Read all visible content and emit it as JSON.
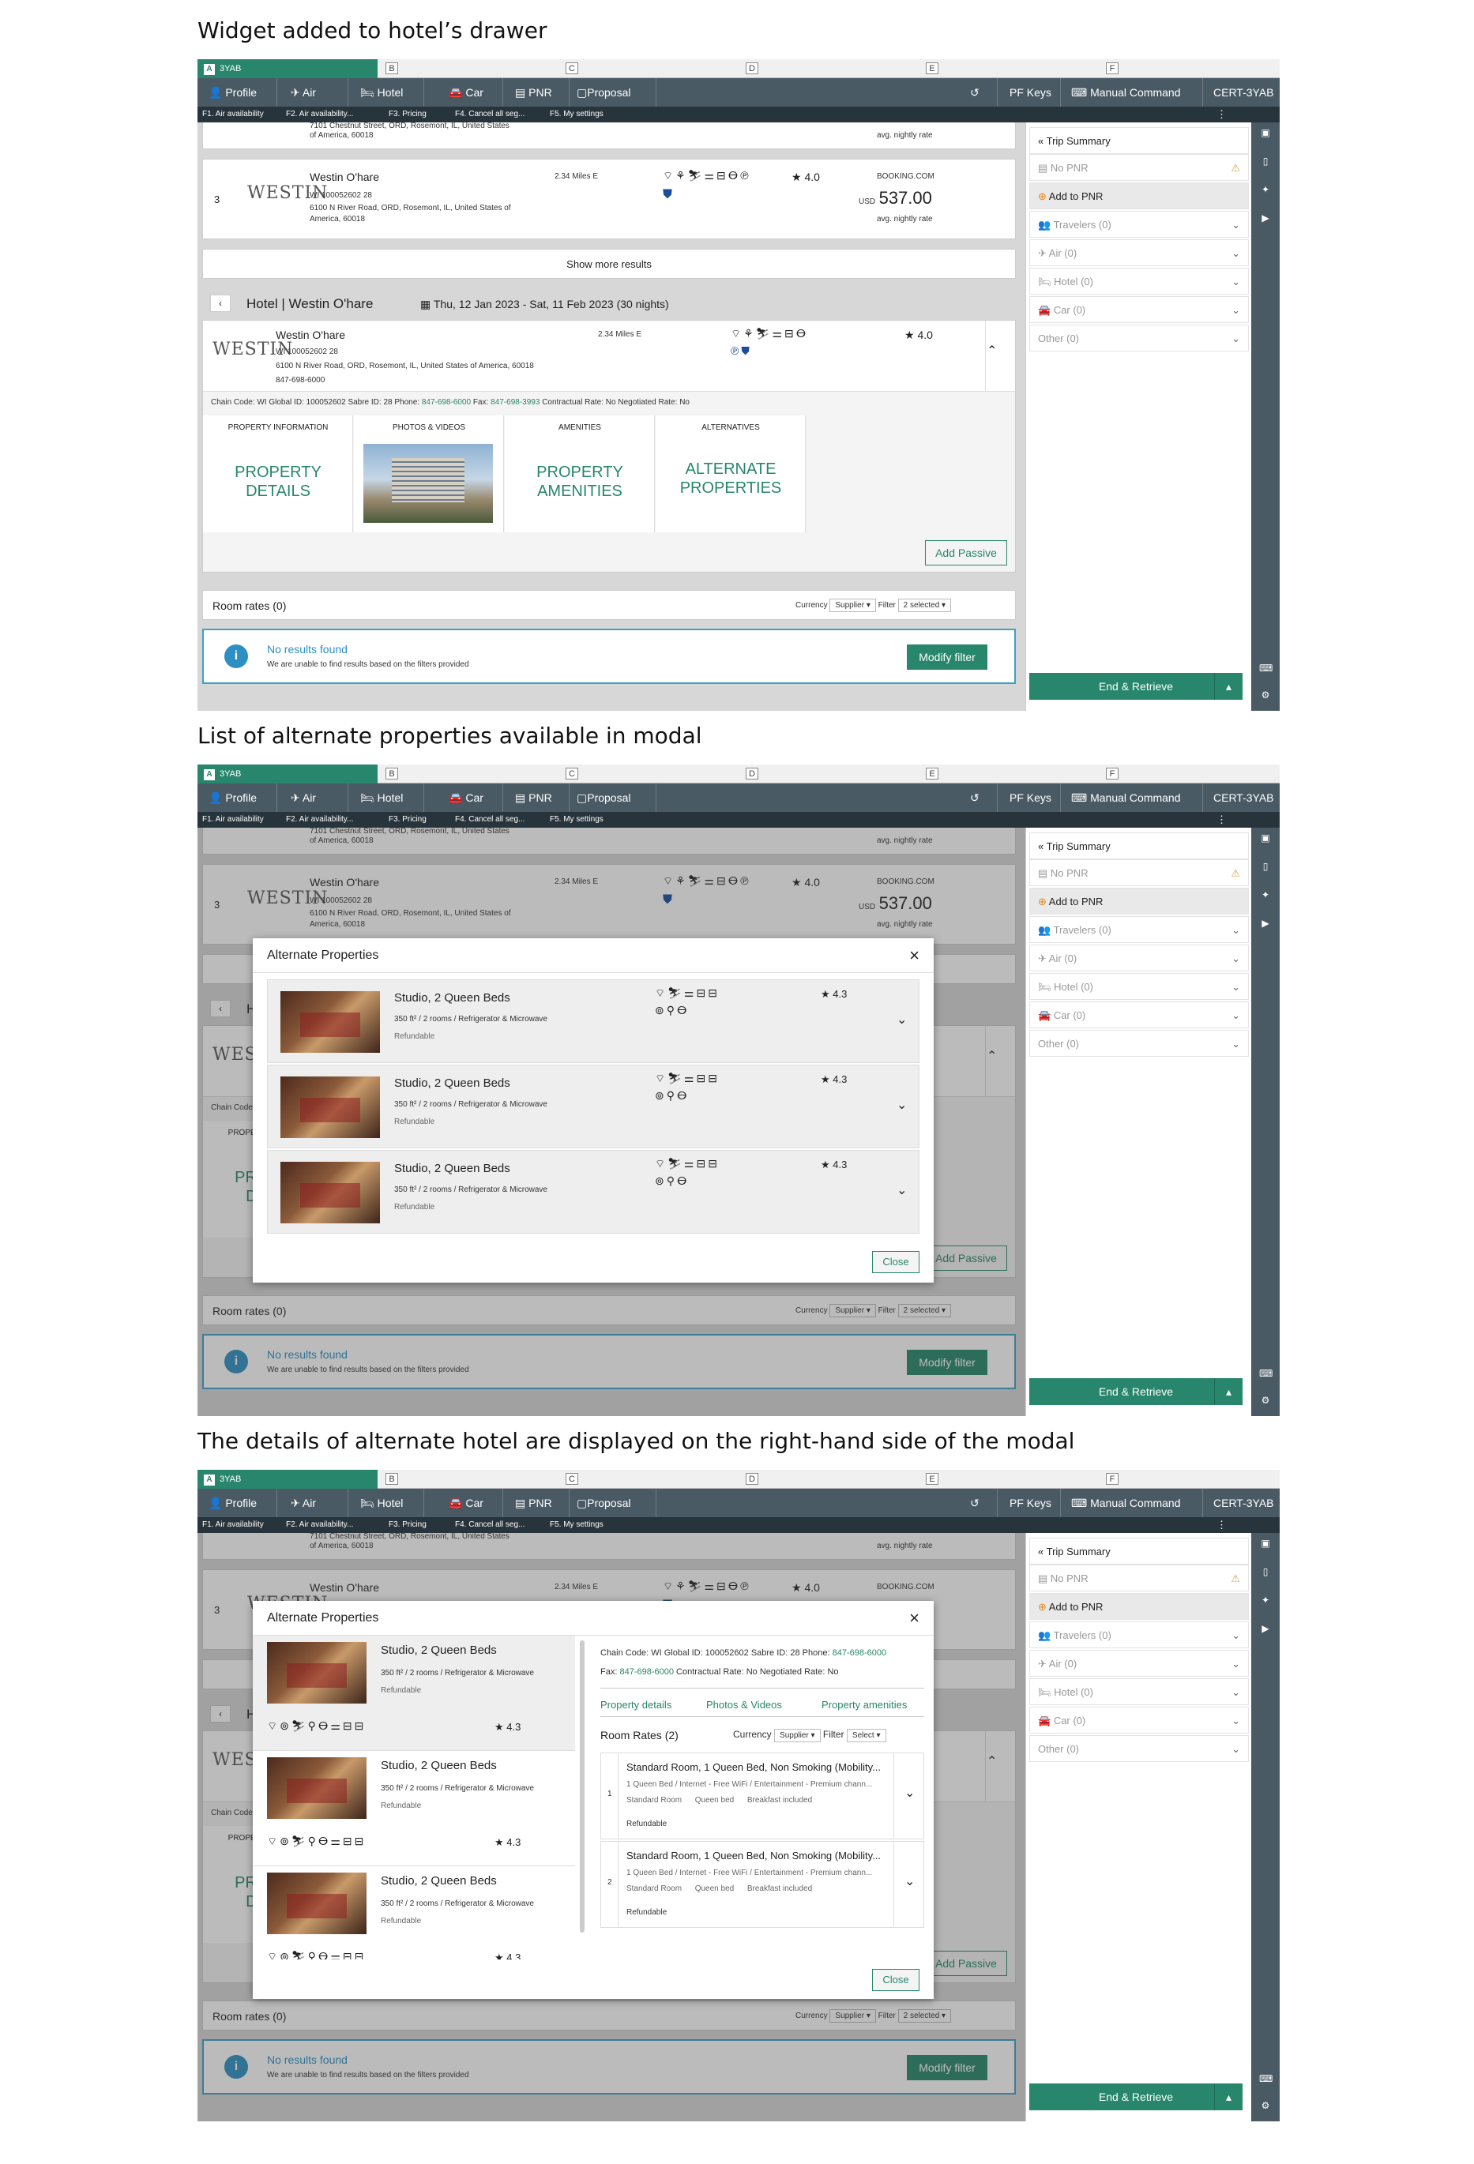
{
  "headings": [
    "Widget added to hotel’s drawer",
    "List of alternate properties available in modal",
    "The details of alternate hotel are displayed on the right-hand side of the modal"
  ],
  "tabstrip": {
    "active": "3YAB",
    "active_letter": "A",
    "letters": [
      "B",
      "C",
      "D",
      "E",
      "F"
    ]
  },
  "nav": {
    "profile": "Profile",
    "air": "Air",
    "hotel": "Hotel",
    "car": "Car",
    "pnr": "PNR",
    "proposal": "Proposal",
    "pfkeys": "PF Keys",
    "manual": "Manual Command",
    "cert": "CERT-3YAB"
  },
  "fkeys": [
    "F1. Air availability",
    "F2. Air availability...",
    "F3. Pricing",
    "F4. Cancel all seg...",
    "F5. My settings"
  ],
  "side": {
    "trip_summary": "Trip Summary",
    "no_pnr": "No PNR",
    "add_to_pnr": "Add to PNR",
    "travelers": "Travelers (0)",
    "air": "Air (0)",
    "hotel": "Hotel (0)",
    "car": "Car (0)",
    "other": "Other (0)",
    "end_retrieve": "End & Retrieve"
  },
  "list": {
    "prev_address1": "7101 Chestnut Street, ORD, Rosemont, IL, United States",
    "prev_address2": "of America, 60018",
    "avg": "avg. nightly rate",
    "index": "3",
    "name": "Westin O'hare",
    "code": "WI 100052602 28",
    "addr1": "6100 N River Road, ORD, Rosemont, IL, United States of",
    "addr2": "America, 60018",
    "distance": "2.34 Miles E",
    "rating": "4.0",
    "source": "BOOKING.COM",
    "currency": "USD",
    "price": "537.00",
    "show_more": "Show more results",
    "logo": "WESTIN"
  },
  "detail": {
    "title": "Hotel | Westin O'hare",
    "dates": "Thu, 12 Jan 2023 - Sat, 11 Feb 2023",
    "nights": "(30 nights)",
    "name": "Westin O'hare",
    "code": "WI 100052602 28",
    "address": "6100 N River Road, ORD, Rosemont, IL, United States of America, 60018",
    "phone": "847-698-6000",
    "distance": "2.34 Miles E",
    "rating": "4.0",
    "chain_line": "Chain Code: WI   Global ID: 100052602   Sabre ID: 28   Phone:",
    "phone_link": "847-698-6000",
    "fax_label": "Fax:",
    "fax": "847-698-3993",
    "rates_line": "Contractual Rate: No   Negotiated Rate: No",
    "tiles": [
      {
        "head": "PROPERTY INFORMATION",
        "big1": "PROPERTY",
        "big2": "DETAILS"
      },
      {
        "head": "PHOTOS & VIDEOS"
      },
      {
        "head": "AMENITIES",
        "big1": "PROPERTY",
        "big2": "AMENITIES"
      },
      {
        "head": "ALTERNATIVES",
        "big1": "ALTERNATE",
        "big2": "PROPERTIES"
      }
    ],
    "add_passive": "Add Passive",
    "room_rates": "Room rates (0)",
    "currency_label": "Currency",
    "currency_val": "Supplier",
    "filter_label": "Filter",
    "filter_val": "2 selected",
    "no_results": "No results found",
    "no_results_sub": "We are unable to find results based on the filters provided",
    "modify": "Modify filter"
  },
  "modal": {
    "title": "Alternate Properties",
    "close": "Close",
    "items": [
      {
        "name": "Studio, 2 Queen Beds",
        "size": "350 ft²",
        "rooms": "/ 2 rooms /",
        "extras": "Refrigerator & Microwave",
        "refund": "Refundable",
        "rating": "4.3"
      },
      {
        "name": "Studio, 2 Queen Beds",
        "size": "350 ft²",
        "rooms": "/ 2 rooms /",
        "extras": "Refrigerator & Microwave",
        "refund": "Refundable",
        "rating": "4.3"
      },
      {
        "name": "Studio, 2 Queen Beds",
        "size": "350 ft²",
        "rooms": "/ 2 rooms /",
        "extras": "Refrigerator & Microwave",
        "refund": "Refundable",
        "rating": "4.3"
      }
    ]
  },
  "modal_detail": {
    "chain": "Chain Code: WI",
    "global": "Global ID: 100052602",
    "sabre": "Sabre ID: 28",
    "phone_label": "Phone:",
    "phone": "847-698-6000",
    "fax_label": "Fax:",
    "fax": "847-698-6000",
    "contractual": "Contractual Rate: No",
    "negotiated": "Negotiated Rate: No",
    "tabs": [
      "Property details",
      "Photos & Videos",
      "Property amenities"
    ],
    "room_rates": "Room Rates (2)",
    "currency_label": "Currency",
    "currency_val": "Supplier",
    "filter_label": "Filter",
    "filter_val": "Select",
    "rates": [
      {
        "num": "1",
        "title": "Standard Room, 1 Queen Bed, Non Smoking (Mobility...",
        "desc": "1 Queen Bed / Internet - Free WiFi / Entertainment - Premium chann...",
        "tags": "Standard Room      Queen bed      Breakfast included",
        "refund": "Refundable"
      },
      {
        "num": "2",
        "title": "Standard Room, 1 Queen Bed, Non Smoking (Mobility...",
        "desc": "1 Queen Bed / Internet - Free WiFi / Entertainment - Premium chann...",
        "tags": "Standard Room      Queen bed      Breakfast included",
        "refund": "Refundable"
      }
    ]
  }
}
